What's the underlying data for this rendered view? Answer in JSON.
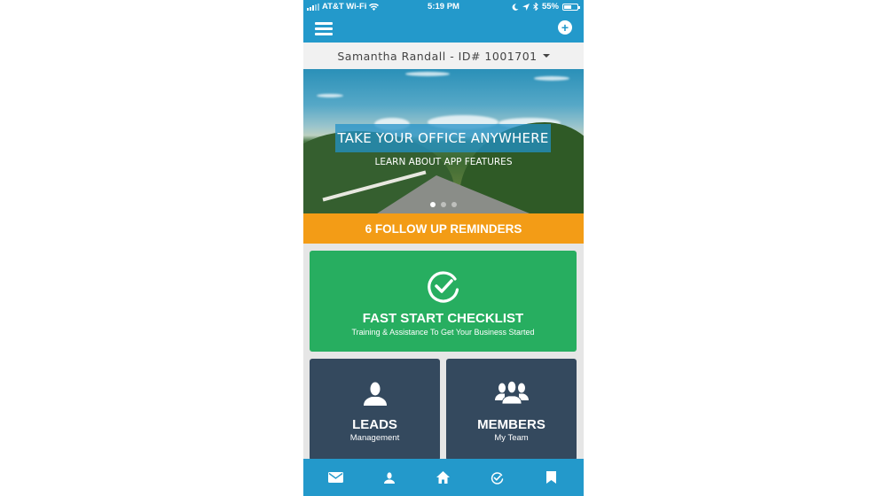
{
  "status_bar": {
    "carrier": "AT&T Wi-Fi",
    "time": "5:19 PM",
    "battery": "55%",
    "battery_level": 0.55
  },
  "account": {
    "label": "Samantha Randall - ID# 1001701"
  },
  "hero": {
    "title": "TAKE YOUR OFFICE ANYWHERE",
    "subtitle": "LEARN ABOUT APP FEATURES",
    "slides": 3,
    "active_slide": 1
  },
  "reminders": {
    "label": "6 FOLLOW UP REMINDERS"
  },
  "tiles": {
    "fast_start": {
      "title": "FAST START CHECKLIST",
      "subtitle": "Training & Assistance To Get Your Business Started"
    },
    "leads": {
      "title": "LEADS",
      "subtitle": "Management"
    },
    "members": {
      "title": "MEMBERS",
      "subtitle": "My Team"
    }
  },
  "bottom_nav": [
    {
      "icon": "mail-icon"
    },
    {
      "icon": "person-icon"
    },
    {
      "icon": "home-icon"
    },
    {
      "icon": "check-circle-icon"
    },
    {
      "icon": "bookmark-icon"
    }
  ],
  "colors": {
    "primary": "#2399cb",
    "orange": "#f39c16",
    "green": "#27ae60",
    "navy": "#34495e"
  }
}
